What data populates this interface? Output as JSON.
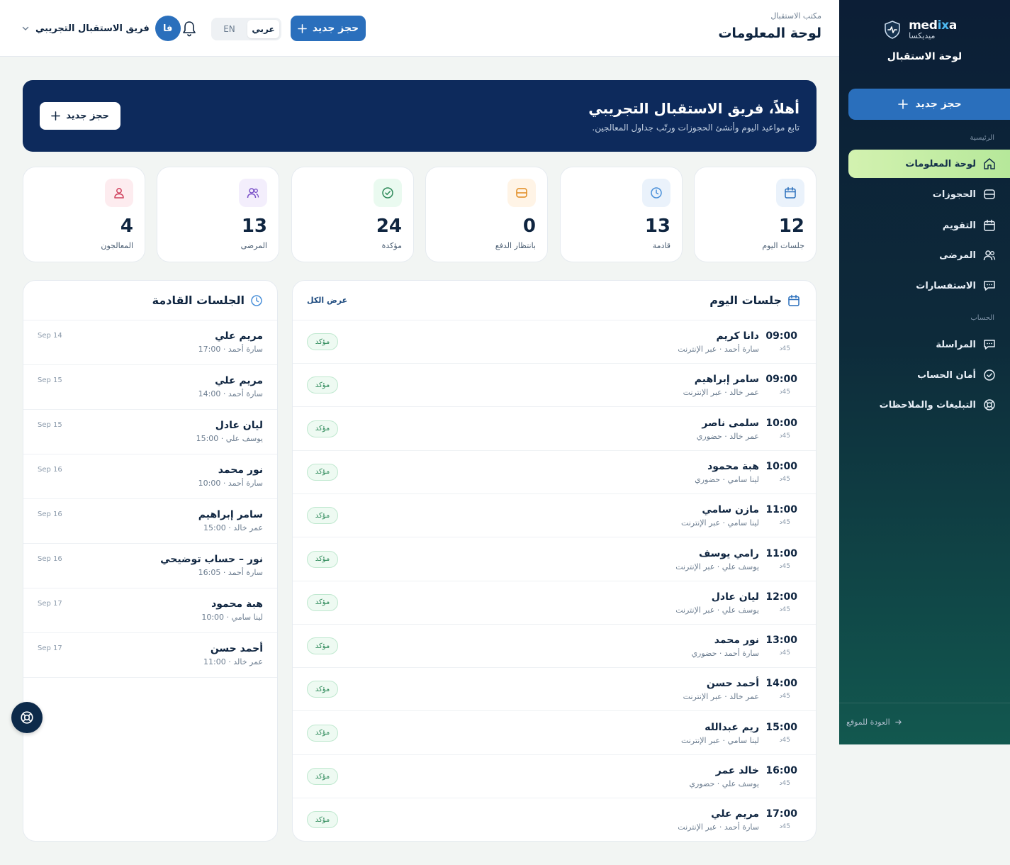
{
  "sidebar": {
    "brand_latin_pre": "med",
    "brand_latin_x": "ix",
    "brand_latin_post": "a",
    "brand_ar": "ميديكسا",
    "title": "لوحة الاستقبال",
    "cta_label": "حجز جديد",
    "section_main": "الرئيسية",
    "section_account": "الحساب",
    "items": [
      {
        "label": "لوحة المعلومات",
        "icon": "home-icon",
        "active": true
      },
      {
        "label": "الحجوزات",
        "icon": "bookings-icon"
      },
      {
        "label": "التقويم",
        "icon": "calendar-icon"
      },
      {
        "label": "المرضى",
        "icon": "users-icon"
      },
      {
        "label": "الاستفسارات",
        "icon": "chat-icon"
      }
    ],
    "account_items": [
      {
        "label": "المراسلة",
        "icon": "chat-icon"
      },
      {
        "label": "أمان الحساب",
        "icon": "check-circle-icon"
      },
      {
        "label": "التبليغات والملاحظات",
        "icon": "lifebuoy-icon"
      }
    ],
    "back_label": "العودة للموقع"
  },
  "header": {
    "subtitle": "مكتب الاستقبال",
    "title": "لوحة المعلومات",
    "new_booking": "حجز جديد",
    "lang_ar": "عربي",
    "lang_en": "EN",
    "avatar_initials": "فا",
    "user_name": "فريق الاستقبال التجريبي"
  },
  "banner": {
    "title": "أهلاً، فريق الاستقبال التجريبي",
    "subtitle": "تابع مواعيد اليوم وأنشئ الحجوزات ورتّب جداول المعالجين.",
    "button": "حجز جديد"
  },
  "stats": [
    {
      "value": "12",
      "label": "جلسات اليوم",
      "icon": "calendar-icon",
      "bg": "#eaf2fb",
      "color": "#2a6fbc"
    },
    {
      "value": "13",
      "label": "قادمة",
      "icon": "clock-icon",
      "bg": "#eaf2fb",
      "color": "#4a90d9"
    },
    {
      "value": "0",
      "label": "بانتظار الدفع",
      "icon": "wallet-icon",
      "bg": "#fff4e6",
      "color": "#e08a1e"
    },
    {
      "value": "24",
      "label": "مؤكدة",
      "icon": "check-circle-icon",
      "bg": "#eafaf0",
      "color": "#2e8a5a"
    },
    {
      "value": "13",
      "label": "المرضى",
      "icon": "users-icon",
      "bg": "#f3eefc",
      "color": "#7b52c9"
    },
    {
      "value": "4",
      "label": "المعالجون",
      "icon": "user-icon",
      "bg": "#fdecef",
      "color": "#d0435f"
    }
  ],
  "today": {
    "title": "جلسات اليوم",
    "view_all": "عرض الكل",
    "rows": [
      {
        "time": "09:00",
        "dur": "45د",
        "name": "دانا كريم",
        "meta": "سارة أحمد · عبر الإنترنت",
        "status": "مؤكد"
      },
      {
        "time": "09:00",
        "dur": "45د",
        "name": "سامر إبراهيم",
        "meta": "عمر خالد · عبر الإنترنت",
        "status": "مؤكد"
      },
      {
        "time": "10:00",
        "dur": "45د",
        "name": "سلمى ناصر",
        "meta": "عمر خالد · حضوري",
        "status": "مؤكد"
      },
      {
        "time": "10:00",
        "dur": "45د",
        "name": "هبة محمود",
        "meta": "لينا سامي · حضوري",
        "status": "مؤكد"
      },
      {
        "time": "11:00",
        "dur": "45د",
        "name": "مازن سامي",
        "meta": "لينا سامي · عبر الإنترنت",
        "status": "مؤكد"
      },
      {
        "time": "11:00",
        "dur": "45د",
        "name": "رامي يوسف",
        "meta": "يوسف علي · عبر الإنترنت",
        "status": "مؤكد"
      },
      {
        "time": "12:00",
        "dur": "45د",
        "name": "ليان عادل",
        "meta": "يوسف علي · عبر الإنترنت",
        "status": "مؤكد"
      },
      {
        "time": "13:00",
        "dur": "45د",
        "name": "نور محمد",
        "meta": "سارة أحمد · حضوري",
        "status": "مؤكد"
      },
      {
        "time": "14:00",
        "dur": "45د",
        "name": "أحمد حسن",
        "meta": "عمر خالد · عبر الإنترنت",
        "status": "مؤكد"
      },
      {
        "time": "15:00",
        "dur": "45د",
        "name": "ريم عبدالله",
        "meta": "لينا سامي · عبر الإنترنت",
        "status": "مؤكد"
      },
      {
        "time": "16:00",
        "dur": "45د",
        "name": "خالد عمر",
        "meta": "يوسف علي · حضوري",
        "status": "مؤكد"
      },
      {
        "time": "17:00",
        "dur": "45د",
        "name": "مريم علي",
        "meta": "سارة أحمد · عبر الإنترنت",
        "status": "مؤكد"
      }
    ]
  },
  "upcoming": {
    "title": "الجلسات القادمة",
    "rows": [
      {
        "name": "مريم علي",
        "meta": "سارة أحمد · 17:00",
        "date": "Sep 14"
      },
      {
        "name": "مريم علي",
        "meta": "سارة أحمد · 14:00",
        "date": "Sep 15"
      },
      {
        "name": "ليان عادل",
        "meta": "يوسف علي · 15:00",
        "date": "Sep 15"
      },
      {
        "name": "نور محمد",
        "meta": "سارة أحمد · 10:00",
        "date": "Sep 16"
      },
      {
        "name": "سامر إبراهيم",
        "meta": "عمر خالد · 15:00",
        "date": "Sep 16"
      },
      {
        "name": "نور – حساب توضيحي",
        "meta": "سارة أحمد · 16:05",
        "date": "Sep 16"
      },
      {
        "name": "هبة محمود",
        "meta": "لينا سامي · 10:00",
        "date": "Sep 17"
      },
      {
        "name": "أحمد حسن",
        "meta": "عمر خالد · 11:00",
        "date": "Sep 17"
      }
    ]
  },
  "fab_icon": "lifebuoy-icon"
}
